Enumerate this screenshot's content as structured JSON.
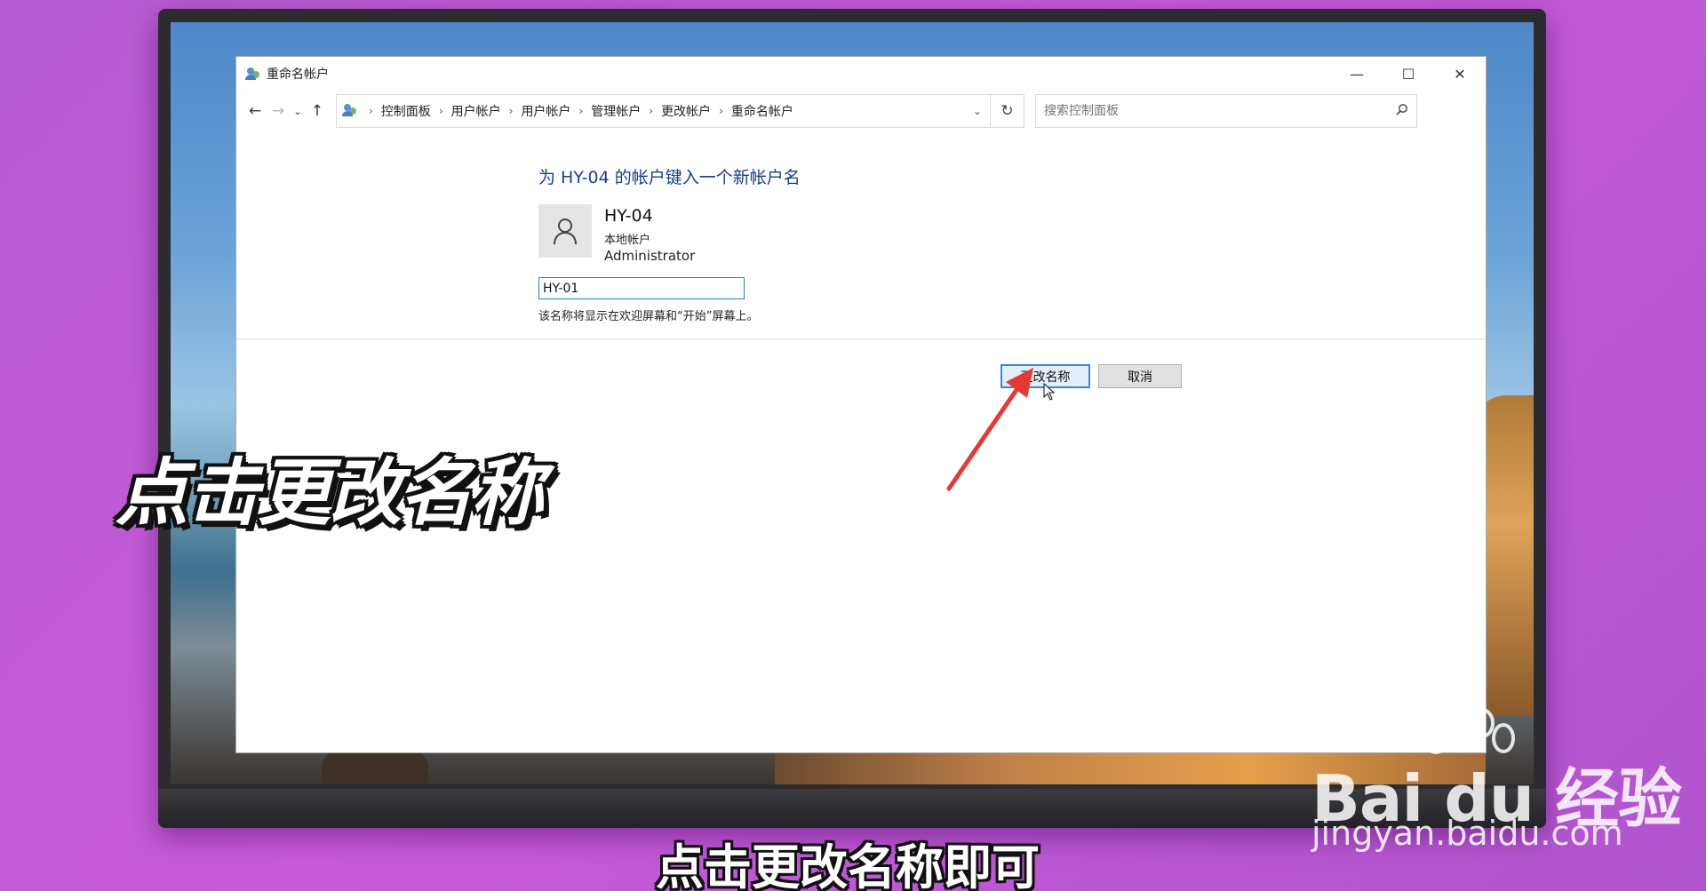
{
  "window": {
    "title": "重命名帐户",
    "minimize_icon": "—",
    "maximize_icon": "☐",
    "close_icon": "✕"
  },
  "nav": {
    "back_icon": "←",
    "forward_icon": "→",
    "recent_icon": "⌄",
    "up_icon": "↑",
    "breadcrumbs": [
      "控制面板",
      "用户帐户",
      "用户帐户",
      "管理帐户",
      "更改帐户",
      "重命名帐户"
    ],
    "separator": "›",
    "dropdown_icon": "⌄",
    "refresh_icon": "↻",
    "search_placeholder": "搜索控制面板",
    "search_icon": "⚲"
  },
  "main": {
    "heading": "为 HY-04 的帐户键入一个新帐户名",
    "user": {
      "name": "HY-04",
      "type": "本地帐户",
      "role": "Administrator"
    },
    "name_input_value": "HY-01",
    "hint": "该名称将显示在欢迎屏幕和“开始”屏幕上。",
    "rename_button": "更改名称",
    "cancel_button": "取消"
  },
  "overlay": {
    "caption": "点击更改名称",
    "subtitle": "点击更改名称即可"
  },
  "watermark": {
    "logo": "Bai du 经验",
    "url": "jingyan.baidu.com"
  },
  "colors": {
    "heading": "#1a3e8c",
    "accent_border": "#3b86d8",
    "arrow": "#e53935",
    "background": "#c75ad8"
  }
}
